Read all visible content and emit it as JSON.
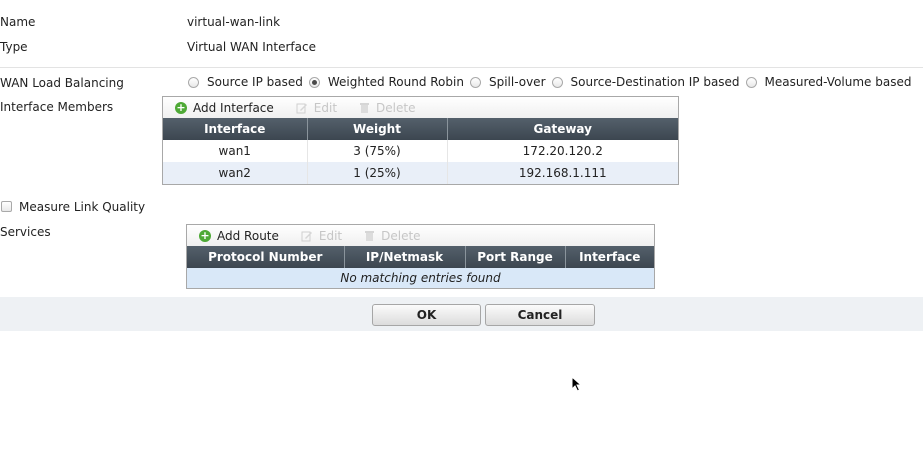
{
  "form": {
    "name_label": "Name",
    "name_value": "virtual-wan-link",
    "type_label": "Type",
    "type_value": "Virtual WAN Interface",
    "lb_label": "WAN Load Balancing",
    "lb_options": [
      {
        "label": "Source IP based",
        "checked": false
      },
      {
        "label": "Weighted Round Robin",
        "checked": true
      },
      {
        "label": "Spill-over",
        "checked": false
      },
      {
        "label": "Source-Destination IP based",
        "checked": false
      },
      {
        "label": "Measured-Volume based",
        "checked": false
      }
    ],
    "members_label": "Interface Members",
    "measure_label": "Measure Link Quality",
    "measure_checked": false,
    "services_label": "Services"
  },
  "members_grid": {
    "toolbar": {
      "add": "Add Interface",
      "edit": "Edit",
      "delete": "Delete"
    },
    "columns": [
      "Interface",
      "Weight",
      "Gateway"
    ],
    "rows": [
      [
        "wan1",
        "3 (75%)",
        "172.20.120.2"
      ],
      [
        "wan2",
        "1 (25%)",
        "192.168.1.111"
      ]
    ]
  },
  "services_grid": {
    "toolbar": {
      "add": "Add Route",
      "edit": "Edit",
      "delete": "Delete"
    },
    "columns": [
      "Protocol Number",
      "IP/Netmask",
      "Port Range",
      "Interface"
    ],
    "empty_text": "No matching entries found"
  },
  "buttons": {
    "ok": "OK",
    "cancel": "Cancel"
  },
  "icons": {
    "add": "add-icon",
    "edit": "edit-icon",
    "delete": "trash-icon",
    "cursor": "mouse-pointer-icon"
  },
  "colors": {
    "header_bg": "#48535d",
    "row_alt": "#e9eff8",
    "empty_row": "#d9e8f8",
    "add_green": "#4ea936",
    "footer_bg": "#eef1f4"
  }
}
